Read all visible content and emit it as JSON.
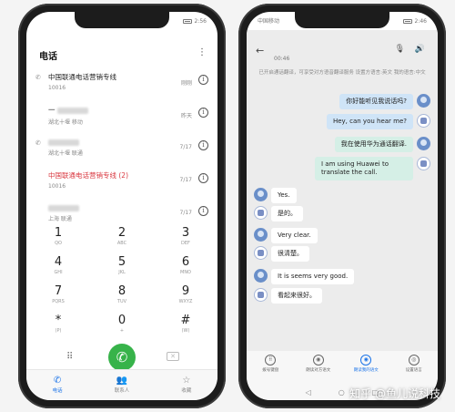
{
  "left_phone": {
    "status": {
      "carrier": "",
      "time": "2:56"
    },
    "title": "电话",
    "menu_icon": "more-vertical-icon",
    "calls": [
      {
        "name": "中国联通电话营销专线",
        "sub": "10016",
        "date": "刚刚",
        "missed": false,
        "blurred": false
      },
      {
        "name": "一",
        "sub": "湖北十堰 移动",
        "date": "昨天",
        "missed": false,
        "blurred": true
      },
      {
        "name": "",
        "sub": "湖北十堰 联通",
        "date": "7/17",
        "missed": false,
        "blurred": true
      },
      {
        "name": "中国联通电话营销专线 (2)",
        "sub": "10016",
        "date": "7/17",
        "missed": true,
        "blurred": false
      },
      {
        "name": "",
        "sub": "上海 联通",
        "date": "7/17",
        "missed": false,
        "blurred": true
      }
    ],
    "keypad": [
      {
        "d": "1",
        "l": "QO"
      },
      {
        "d": "2",
        "l": "ABC"
      },
      {
        "d": "3",
        "l": "DEF"
      },
      {
        "d": "4",
        "l": "GHI"
      },
      {
        "d": "5",
        "l": "JKL"
      },
      {
        "d": "6",
        "l": "MNO"
      },
      {
        "d": "7",
        "l": "PQRS"
      },
      {
        "d": "8",
        "l": "TUV"
      },
      {
        "d": "9",
        "l": "WXYZ"
      },
      {
        "d": "*",
        "l": "(P)"
      },
      {
        "d": "0",
        "l": "+"
      },
      {
        "d": "#",
        "l": "(W)"
      }
    ],
    "nav": [
      {
        "label": "电话",
        "icon": "phone-icon",
        "active": true
      },
      {
        "label": "联系人",
        "icon": "contacts-icon",
        "active": false
      },
      {
        "label": "收藏",
        "icon": "star-icon",
        "active": false
      }
    ],
    "accent": "#1a73e8",
    "call_button_color": "#37b34a"
  },
  "right_phone": {
    "status": {
      "carrier": "中国移动",
      "time": "2:46"
    },
    "timer": "00:46",
    "notice": "已开启通话翻译，可享受对方语音翻译服务 设置方语言:英文 我的语言:中文",
    "notice_tag": "",
    "messages": [
      {
        "side": "r",
        "text": "你好能听见我说话吗?",
        "style": "blue",
        "avatar": "user"
      },
      {
        "side": "r",
        "text": "Hey, can you hear me?",
        "style": "blue",
        "avatar": "bot"
      },
      {
        "side": "r",
        "text": "我在使用华为通话翻译.",
        "style": "green",
        "avatar": "user"
      },
      {
        "side": "r",
        "text": "I am using Huawei to translate the call.",
        "style": "green",
        "avatar": "bot"
      },
      {
        "side": "l",
        "text": "Yes.",
        "style": "white",
        "avatar": "user"
      },
      {
        "side": "l",
        "text": "是的。",
        "style": "white",
        "avatar": "bot"
      },
      {
        "side": "l",
        "text": "Very clear.",
        "style": "white",
        "avatar": "user"
      },
      {
        "side": "l",
        "text": "很清楚。",
        "style": "white",
        "avatar": "bot"
      },
      {
        "side": "l",
        "text": "It is seems very good.",
        "style": "white",
        "avatar": "user"
      },
      {
        "side": "l",
        "text": "看起来很好。",
        "style": "white",
        "avatar": "bot"
      }
    ],
    "tools": [
      {
        "label": "拨号键盘",
        "active": false
      },
      {
        "label": "朗读对方语文",
        "active": false
      },
      {
        "label": "朗读我的语文",
        "active": true
      },
      {
        "label": "设置语言",
        "active": false
      }
    ]
  },
  "watermark": "知乎 @鱼儿说科技"
}
